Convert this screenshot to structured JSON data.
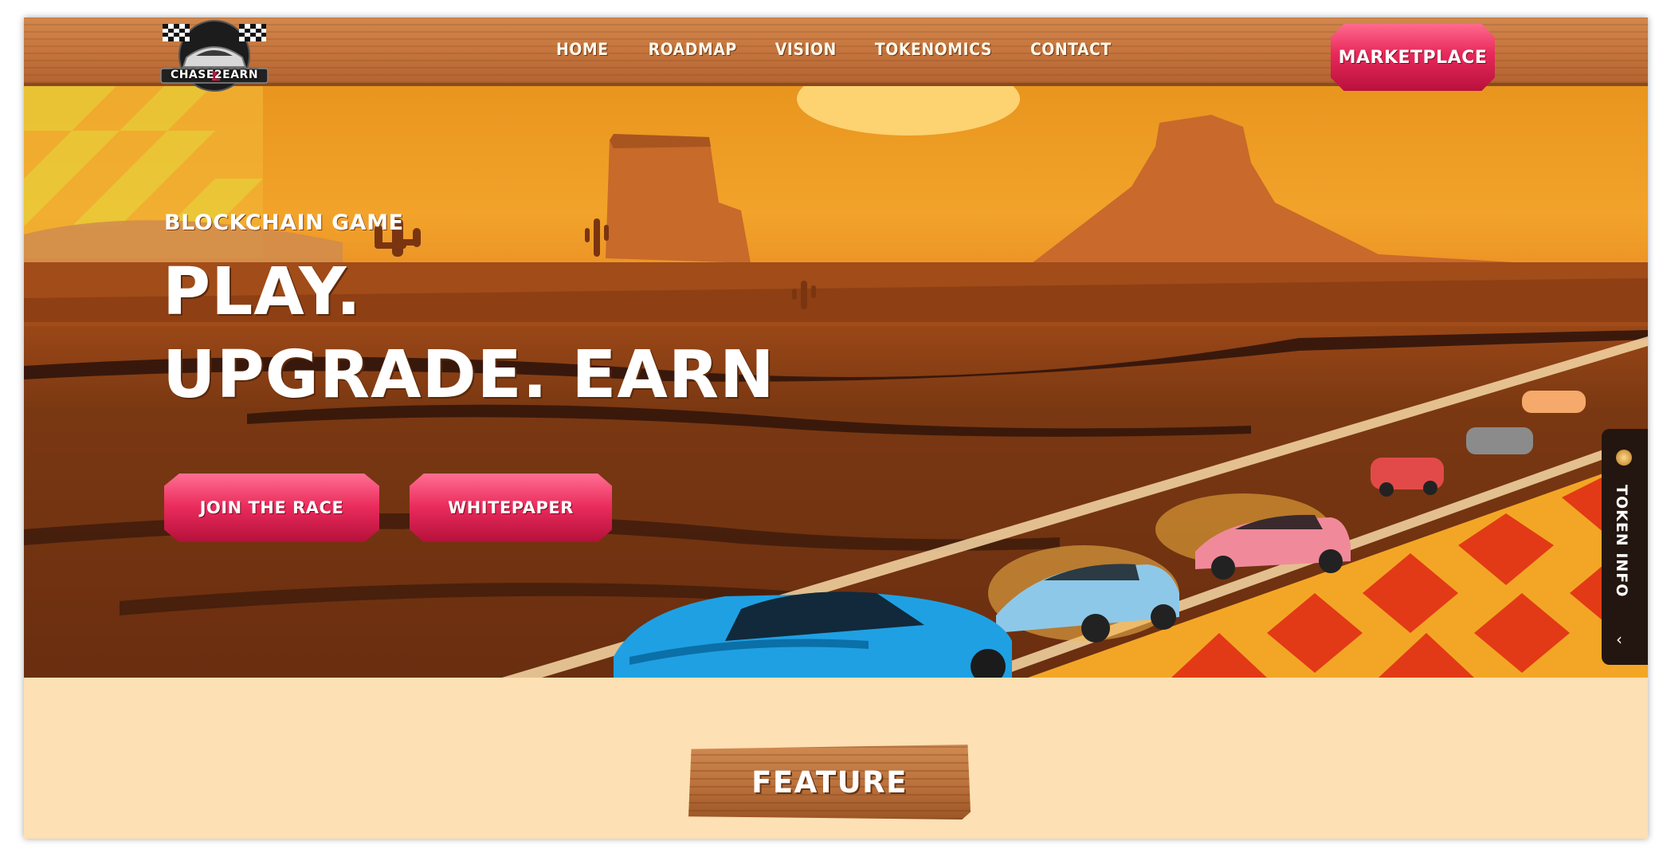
{
  "nav": {
    "logo_text": "CHASE2EARN",
    "links": [
      "HOME",
      "ROADMAP",
      "VISION",
      "TOKENOMICS",
      "CONTACT"
    ],
    "marketplace": "MARKETPLACE"
  },
  "hero": {
    "subtitle": "BLOCKCHAIN GAME",
    "line1": "PLAY.",
    "line2": "UPGRADE. EARN",
    "join": "JOIN THE RACE",
    "whitepaper": "WHITEPAPER"
  },
  "token_tab": {
    "label": "TOKEN INFO",
    "chevron": "‹"
  },
  "feature": {
    "heading": "FEATURE"
  },
  "icons": [
    "chase2earn-logo",
    "racing-flags-icon",
    "token-coin-icon",
    "chevron-left-icon"
  ],
  "colors": {
    "accent": "#e8285a",
    "wood": "#c7773f",
    "sky": "#f2a32a",
    "panel": "#fde0b3"
  }
}
